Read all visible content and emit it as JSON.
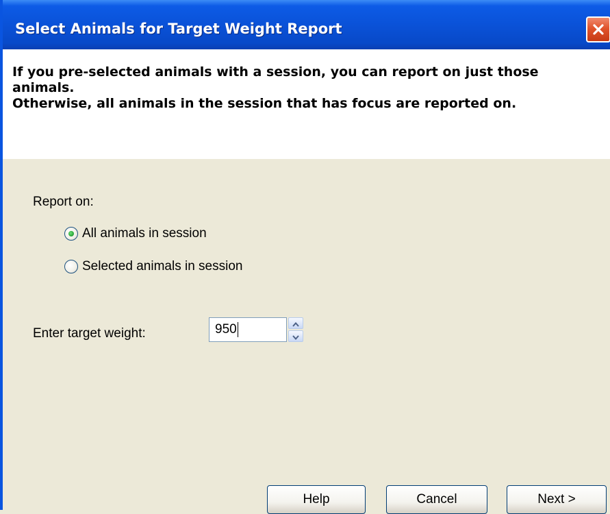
{
  "window": {
    "title": "Select Animals for Target Weight Report",
    "close_icon": "close-icon",
    "titlebar_color": "#0A52D8"
  },
  "header": {
    "line1": "If you pre-selected animals with a session, you can report on just those animals.",
    "line2": "Otherwise, all animals in the session that has focus are reported on."
  },
  "report": {
    "label": "Report on:",
    "options": [
      {
        "label": "All animals in session",
        "selected": true
      },
      {
        "label": "Selected animals in session",
        "selected": false
      }
    ]
  },
  "target_weight": {
    "label": "Enter target weight:",
    "value": "950"
  },
  "buttons": {
    "help": "Help",
    "cancel": "Cancel",
    "next": "Next >"
  }
}
